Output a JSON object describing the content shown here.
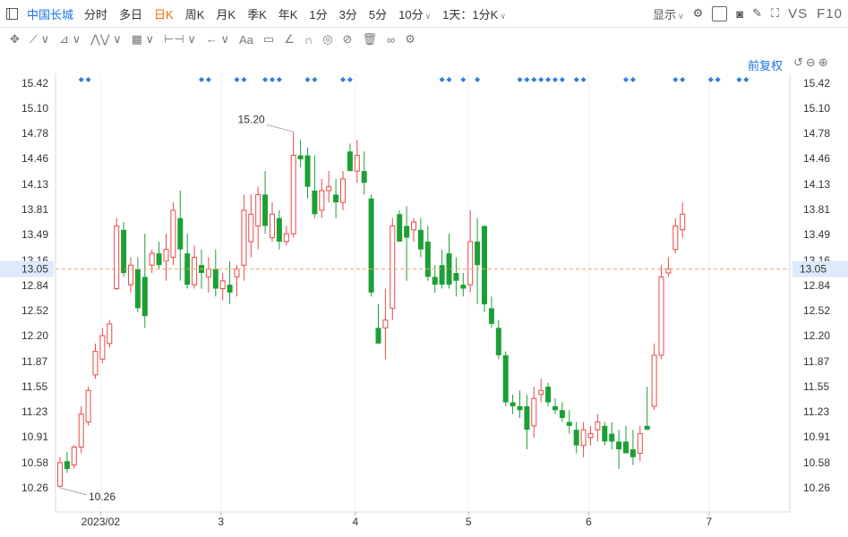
{
  "header": {
    "stock_name": "中国长城",
    "periods": [
      "分时",
      "多日",
      "日K",
      "周K",
      "月K",
      "季K",
      "年K",
      "1分",
      "3分",
      "5分",
      "10分"
    ],
    "active_period": "日K",
    "composite_period": "1天：1分K",
    "display_label": "显示",
    "vs_label": "VS",
    "f10_label": "F10"
  },
  "toolbar": {
    "text_tool": "Aa"
  },
  "adjust_label": "前复权",
  "colors": {
    "up": "#e84a4a",
    "down": "#1ca035",
    "accent": "#1a73e8",
    "crosshair": "#f3a46e",
    "active": "#f56c00"
  },
  "chart_data": {
    "type": "candlestick",
    "title": "",
    "ylim": [
      10.1,
      15.55
    ],
    "y_ticks": [
      "15.42",
      "15.10",
      "14.78",
      "14.46",
      "14.13",
      "13.81",
      "13.49",
      "13.16",
      "12.84",
      "12.52",
      "12.20",
      "11.87",
      "11.55",
      "11.23",
      "10.91",
      "10.58",
      "10.26"
    ],
    "x_ticks": [
      {
        "index": 6,
        "label": "2023/02"
      },
      {
        "index": 23,
        "label": "3"
      },
      {
        "index": 42,
        "label": "4"
      },
      {
        "index": 58,
        "label": "5"
      },
      {
        "index": 75,
        "label": "6"
      },
      {
        "index": 92,
        "label": "7"
      }
    ],
    "current_price": "13.05",
    "max_label": "15.20",
    "min_label": "10.26",
    "marker_indices": [
      3,
      4,
      20,
      21,
      25,
      26,
      29,
      30,
      31,
      35,
      36,
      40,
      41,
      54,
      55,
      57,
      59,
      65,
      66,
      67,
      68,
      69,
      70,
      71,
      73,
      74,
      80,
      81,
      87,
      88,
      92,
      93,
      96,
      97
    ],
    "candles": [
      {
        "o": 10.28,
        "h": 10.65,
        "l": 10.26,
        "c": 10.58
      },
      {
        "o": 10.6,
        "h": 10.72,
        "l": 10.45,
        "c": 10.5
      },
      {
        "o": 10.55,
        "h": 10.8,
        "l": 10.5,
        "c": 10.78
      },
      {
        "o": 10.78,
        "h": 11.3,
        "l": 10.7,
        "c": 11.2
      },
      {
        "o": 11.1,
        "h": 11.55,
        "l": 11.05,
        "c": 11.5
      },
      {
        "o": 11.7,
        "h": 12.1,
        "l": 11.65,
        "c": 12.0
      },
      {
        "o": 11.9,
        "h": 12.3,
        "l": 11.85,
        "c": 12.2
      },
      {
        "o": 12.1,
        "h": 12.4,
        "l": 12.05,
        "c": 12.35
      },
      {
        "o": 12.8,
        "h": 13.7,
        "l": 12.78,
        "c": 13.6
      },
      {
        "o": 13.55,
        "h": 13.65,
        "l": 12.95,
        "c": 13.0
      },
      {
        "o": 12.85,
        "h": 13.2,
        "l": 12.75,
        "c": 13.1
      },
      {
        "o": 13.05,
        "h": 13.2,
        "l": 12.5,
        "c": 12.55
      },
      {
        "o": 12.95,
        "h": 13.5,
        "l": 12.3,
        "c": 12.45
      },
      {
        "o": 13.1,
        "h": 13.3,
        "l": 13.0,
        "c": 13.25
      },
      {
        "o": 13.25,
        "h": 13.4,
        "l": 13.05,
        "c": 13.1
      },
      {
        "o": 13.15,
        "h": 13.5,
        "l": 12.9,
        "c": 13.3
      },
      {
        "o": 13.2,
        "h": 13.9,
        "l": 13.1,
        "c": 13.8
      },
      {
        "o": 13.7,
        "h": 14.05,
        "l": 12.9,
        "c": 13.3
      },
      {
        "o": 13.25,
        "h": 13.5,
        "l": 12.8,
        "c": 12.85
      },
      {
        "o": 12.85,
        "h": 13.35,
        "l": 12.8,
        "c": 13.2
      },
      {
        "o": 13.1,
        "h": 13.3,
        "l": 12.8,
        "c": 13.0
      },
      {
        "o": 12.95,
        "h": 13.2,
        "l": 12.75,
        "c": 13.05
      },
      {
        "o": 13.05,
        "h": 13.3,
        "l": 12.7,
        "c": 12.8
      },
      {
        "o": 12.8,
        "h": 13.0,
        "l": 12.65,
        "c": 12.9
      },
      {
        "o": 12.85,
        "h": 13.15,
        "l": 12.6,
        "c": 12.75
      },
      {
        "o": 12.95,
        "h": 13.1,
        "l": 12.7,
        "c": 13.05
      },
      {
        "o": 13.1,
        "h": 14.0,
        "l": 12.9,
        "c": 13.8
      },
      {
        "o": 13.4,
        "h": 14.0,
        "l": 13.2,
        "c": 13.75
      },
      {
        "o": 13.6,
        "h": 14.1,
        "l": 13.3,
        "c": 14.0
      },
      {
        "o": 14.0,
        "h": 14.3,
        "l": 13.5,
        "c": 13.6
      },
      {
        "o": 13.45,
        "h": 13.9,
        "l": 13.4,
        "c": 13.75
      },
      {
        "o": 13.7,
        "h": 13.8,
        "l": 13.3,
        "c": 13.4
      },
      {
        "o": 13.4,
        "h": 13.6,
        "l": 13.35,
        "c": 13.5
      },
      {
        "o": 13.5,
        "h": 14.8,
        "l": 13.45,
        "c": 14.5
      },
      {
        "o": 14.5,
        "h": 14.7,
        "l": 14.35,
        "c": 14.45
      },
      {
        "o": 14.5,
        "h": 14.6,
        "l": 13.95,
        "c": 14.1
      },
      {
        "o": 14.05,
        "h": 14.5,
        "l": 13.7,
        "c": 13.75
      },
      {
        "o": 13.8,
        "h": 14.2,
        "l": 13.7,
        "c": 14.05
      },
      {
        "o": 14.05,
        "h": 14.3,
        "l": 13.9,
        "c": 14.1
      },
      {
        "o": 14.0,
        "h": 14.2,
        "l": 13.7,
        "c": 13.9
      },
      {
        "o": 13.9,
        "h": 14.3,
        "l": 13.8,
        "c": 14.2
      },
      {
        "o": 14.55,
        "h": 14.65,
        "l": 14.3,
        "c": 14.3
      },
      {
        "o": 14.3,
        "h": 14.7,
        "l": 14.15,
        "c": 14.5
      },
      {
        "o": 14.3,
        "h": 14.55,
        "l": 14.0,
        "c": 14.15
      },
      {
        "o": 13.95,
        "h": 14.0,
        "l": 12.7,
        "c": 12.75
      },
      {
        "o": 12.3,
        "h": 12.6,
        "l": 12.1,
        "c": 12.1
      },
      {
        "o": 12.3,
        "h": 12.8,
        "l": 11.9,
        "c": 12.4
      },
      {
        "o": 12.55,
        "h": 13.7,
        "l": 12.4,
        "c": 13.6
      },
      {
        "o": 13.75,
        "h": 13.8,
        "l": 13.4,
        "c": 13.4
      },
      {
        "o": 13.6,
        "h": 13.85,
        "l": 12.9,
        "c": 13.45
      },
      {
        "o": 13.55,
        "h": 13.7,
        "l": 13.4,
        "c": 13.65
      },
      {
        "o": 13.55,
        "h": 13.7,
        "l": 13.2,
        "c": 13.3
      },
      {
        "o": 13.4,
        "h": 13.6,
        "l": 12.9,
        "c": 12.95
      },
      {
        "o": 12.95,
        "h": 13.1,
        "l": 12.75,
        "c": 12.85
      },
      {
        "o": 13.1,
        "h": 13.3,
        "l": 12.8,
        "c": 12.85
      },
      {
        "o": 13.25,
        "h": 13.5,
        "l": 12.8,
        "c": 12.85
      },
      {
        "o": 13.0,
        "h": 13.2,
        "l": 12.7,
        "c": 12.9
      },
      {
        "o": 12.85,
        "h": 13.0,
        "l": 12.7,
        "c": 12.8
      },
      {
        "o": 12.85,
        "h": 13.8,
        "l": 12.75,
        "c": 13.4
      },
      {
        "o": 13.4,
        "h": 13.7,
        "l": 12.6,
        "c": 13.1
      },
      {
        "o": 13.6,
        "h": 13.6,
        "l": 12.5,
        "c": 12.6
      },
      {
        "o": 12.55,
        "h": 12.7,
        "l": 12.3,
        "c": 12.35
      },
      {
        "o": 12.3,
        "h": 12.4,
        "l": 11.9,
        "c": 11.95
      },
      {
        "o": 11.95,
        "h": 12.0,
        "l": 11.3,
        "c": 11.35
      },
      {
        "o": 11.35,
        "h": 11.45,
        "l": 11.2,
        "c": 11.3
      },
      {
        "o": 11.3,
        "h": 11.5,
        "l": 11.15,
        "c": 11.25
      },
      {
        "o": 11.3,
        "h": 11.45,
        "l": 10.75,
        "c": 11.0
      },
      {
        "o": 11.05,
        "h": 11.55,
        "l": 10.9,
        "c": 11.4
      },
      {
        "o": 11.45,
        "h": 11.65,
        "l": 11.35,
        "c": 11.5
      },
      {
        "o": 11.55,
        "h": 11.6,
        "l": 11.3,
        "c": 11.35
      },
      {
        "o": 11.3,
        "h": 11.4,
        "l": 11.2,
        "c": 11.25
      },
      {
        "o": 11.25,
        "h": 11.35,
        "l": 11.1,
        "c": 11.15
      },
      {
        "o": 11.1,
        "h": 11.25,
        "l": 10.95,
        "c": 11.05
      },
      {
        "o": 11.0,
        "h": 11.1,
        "l": 10.7,
        "c": 10.8
      },
      {
        "o": 10.8,
        "h": 11.1,
        "l": 10.65,
        "c": 11.0
      },
      {
        "o": 10.9,
        "h": 11.05,
        "l": 10.8,
        "c": 10.95
      },
      {
        "o": 11.0,
        "h": 11.2,
        "l": 10.85,
        "c": 11.1
      },
      {
        "o": 11.05,
        "h": 11.1,
        "l": 10.8,
        "c": 10.85
      },
      {
        "o": 10.95,
        "h": 11.1,
        "l": 10.75,
        "c": 10.85
      },
      {
        "o": 10.85,
        "h": 11.0,
        "l": 10.5,
        "c": 10.75
      },
      {
        "o": 10.85,
        "h": 11.05,
        "l": 10.7,
        "c": 10.7
      },
      {
        "o": 10.75,
        "h": 11.0,
        "l": 10.55,
        "c": 10.65
      },
      {
        "o": 10.7,
        "h": 11.05,
        "l": 10.6,
        "c": 10.95
      },
      {
        "o": 11.05,
        "h": 11.55,
        "l": 11.0,
        "c": 11.0
      },
      {
        "o": 11.3,
        "h": 12.1,
        "l": 11.25,
        "c": 11.95
      },
      {
        "o": 11.95,
        "h": 13.1,
        "l": 11.9,
        "c": 12.95
      },
      {
        "o": 13.0,
        "h": 13.2,
        "l": 12.95,
        "c": 13.05
      },
      {
        "o": 13.3,
        "h": 13.7,
        "l": 13.25,
        "c": 13.6
      },
      {
        "o": 13.55,
        "h": 13.9,
        "l": 13.45,
        "c": 13.75
      }
    ]
  }
}
